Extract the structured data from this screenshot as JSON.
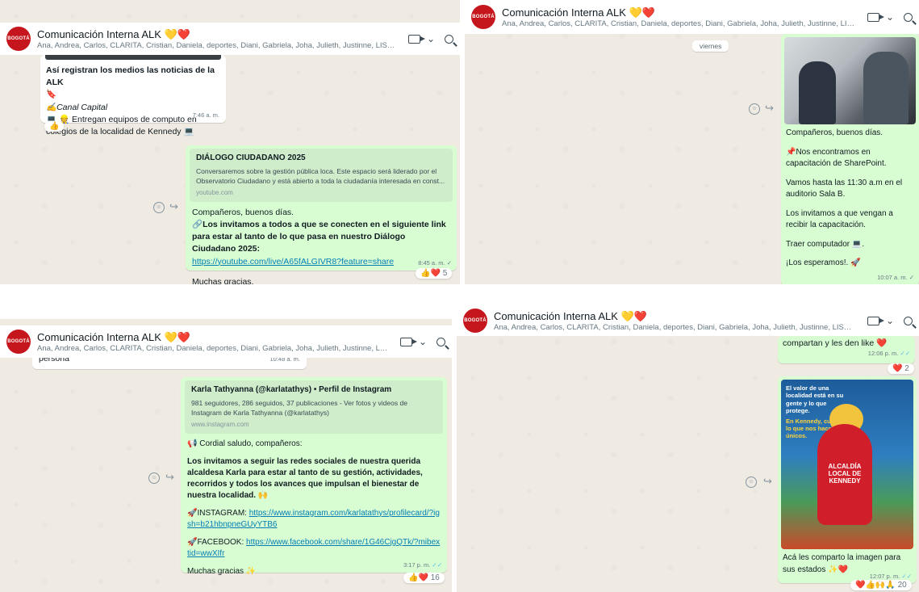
{
  "chat": {
    "title": "Comunicación Interna ALK",
    "title_emoji": "💛❤️",
    "members": "Ana, Andrea, Carlos, CLARITA, Cristian, Daniela, deportes, Diani, Gabriela, Joha, Julieth, Justinne, LISReyes...",
    "logo_text": "BOGOTÁ",
    "chevron": "⌄"
  },
  "panel1": {
    "news_title": "Así registran los medios las noticias de la ALK",
    "news_emoji": "🔖",
    "news_channel": "✍️Canal Capital",
    "news_headline": "💻 👷 Entregan equipos de computo en colegios de la localidad de Kennedy 💻",
    "news_time": "7:46 a. m.",
    "news_reaction": "👍",
    "preview_title": "DIÁLOGO CIUDADANO 2025",
    "preview_desc": "Conversaremos sobre la gestión pública loca. Este espacio será liderado por el Observatorio Ciudadano y está abierto a toda la ciudadanía interesada en const...",
    "preview_domain": "youtube.com",
    "greeting": "Compañeros, buenos días.",
    "invite": "🔗Los invitamos a todos a que se conecten en el siguiente link para estar al tanto de lo que pasa en nuestro Diálogo Ciudadano 2025:",
    "link": "https://youtube.com/live/A65fALGIVR8?feature=share",
    "thanks": "Muchas gracias.",
    "time": "8:45 a. m.",
    "check": "✓",
    "reactions": "👍❤️",
    "reaction_count": "5"
  },
  "panel2": {
    "day": "viernes",
    "l1": "Compañeros, buenos días.",
    "l2": "📌Nos encontramos en capacitación de SharePoint.",
    "l3": "Vamos hasta las 11:30 a.m en el auditorio Sala B.",
    "l4": "Los invitamos a que vengan a recibir la capacitación.",
    "l5": "Traer computador 💻.",
    "l6": "¡Los esperamos!. 🚀",
    "time": "10:07 a. m.",
    "check": "✓"
  },
  "panel3": {
    "prev_msg": "persona",
    "prev_time": "10:48 a. m.",
    "preview_title": "Karla Tathyanna (@karlatathys) • Perfil de Instagram",
    "preview_desc": "981 seguidores, 286 seguidos, 37 publicaciones - Ver fotos y videos de Instagram de Karla Tathyanna (@karlatathys)",
    "preview_domain": "www.instagram.com",
    "greeting": "📢 Cordial saludo, compañeros:",
    "body": "Los invitamos a seguir las redes sociales de nuestra querida alcaldesa Karla para estar al tanto de su gestión, actividades, recorridos y todos los avances que impulsan el bienestar de nuestra localidad. 🙌",
    "ig_label": "🚀INSTAGRAM: ",
    "ig_link": "https://www.instagram.com/karlatathys/profilecard/?igsh=b21hbnpneGUyYTB6",
    "fb_label": "🚀FACEBOOK: ",
    "fb_link": "https://www.facebook.com/share/1G46CjgQTk/?mibextid=wwXIfr",
    "thanks": "Muchas gracias ✨",
    "time": "3:17 p. m.",
    "check": "✓✓",
    "reactions": "👍❤️",
    "reaction_count": "16"
  },
  "panel4": {
    "prev_msg": "compartan y les den like ❤️",
    "prev_time": "12:06 p. m.",
    "check": "✓✓",
    "prev_reactions": "❤️",
    "prev_reaction_count": "2",
    "poster_line1": "El valor de una localidad está en su gente y lo que protege.",
    "poster_line2": "En Kennedy, cuidamos lo que nos hace únicos.",
    "mascot_text": "ALCALDÍA LOCAL DE KENNEDY",
    "caption": "Acá les comparto la imagen para sus estados ✨❤️",
    "time": "12:07 p. m.",
    "reactions": "❤️👍🙌🙏",
    "reaction_count": "20"
  },
  "icons": {
    "emoji": "emoji-icon",
    "forward": "forward-icon",
    "video": "video-call-icon",
    "search": "search-icon"
  }
}
